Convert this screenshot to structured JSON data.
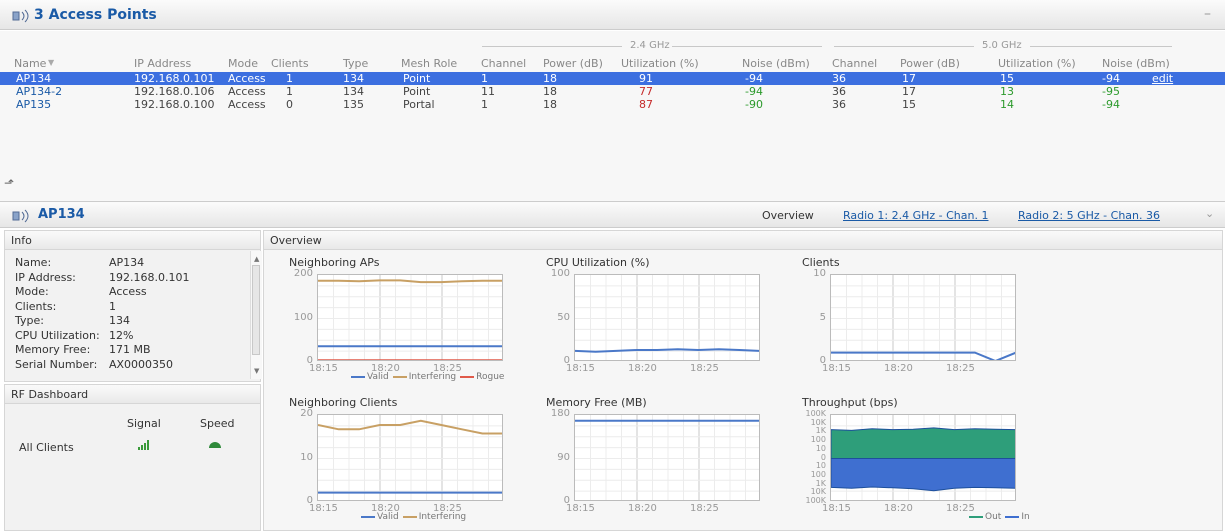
{
  "header": {
    "title": "3 Access Points"
  },
  "table": {
    "group_24": "2.4 GHz",
    "group_5": "5.0 GHz",
    "columns": [
      "Name",
      "IP Address",
      "Mode",
      "Clients",
      "Type",
      "Mesh Role",
      "Channel",
      "Power (dB)",
      "Utilization (%)",
      "Noise (dBm)",
      "Channel",
      "Power (dB)",
      "Utilization (%)",
      "Noise (dBm)"
    ],
    "rows": [
      {
        "name": "AP134",
        "ip": "192.168.0.101",
        "mode": "Access",
        "clients": "1",
        "type": "134",
        "mesh": "Point",
        "ch24": "1",
        "pw24": "18",
        "ut24": "91",
        "no24": "-94",
        "ch5": "36",
        "pw5": "17",
        "ut5": "15",
        "no5": "-94",
        "action": "edit"
      },
      {
        "name": "AP134-2",
        "ip": "192.168.0.106",
        "mode": "Access",
        "clients": "1",
        "type": "134",
        "mesh": "Point",
        "ch24": "11",
        "pw24": "18",
        "ut24": "77",
        "no24": "-94",
        "ch5": "36",
        "pw5": "17",
        "ut5": "13",
        "no5": "-95",
        "action": ""
      },
      {
        "name": "AP135",
        "ip": "192.168.0.100",
        "mode": "Access",
        "clients": "0",
        "type": "135",
        "mesh": "Portal",
        "ch24": "1",
        "pw24": "18",
        "ut24": "87",
        "no24": "-90",
        "ch5": "36",
        "pw5": "15",
        "ut5": "14",
        "no5": "-94",
        "action": ""
      }
    ]
  },
  "ap": {
    "title": "AP134",
    "overview": "Overview",
    "radio1": "Radio 1: 2.4 GHz - Chan. 1",
    "radio2": "Radio 2: 5 GHz - Chan. 36"
  },
  "info": {
    "title": "Info",
    "rows": [
      {
        "k": "Name:",
        "v": "AP134"
      },
      {
        "k": "IP Address:",
        "v": "192.168.0.101"
      },
      {
        "k": "Mode:",
        "v": "Access"
      },
      {
        "k": "Clients:",
        "v": "1"
      },
      {
        "k": "Type:",
        "v": "134"
      },
      {
        "k": "CPU Utilization:",
        "v": "12%"
      },
      {
        "k": "Memory Free:",
        "v": "171 MB"
      },
      {
        "k": "Serial Number:",
        "v": "AX0000350"
      }
    ]
  },
  "rf": {
    "title": "RF Dashboard",
    "signal": "Signal",
    "speed": "Speed",
    "row": "All Clients"
  },
  "overview": {
    "title": "Overview"
  },
  "colors": {
    "valid": "#4a78c8",
    "interfering": "#c8a064",
    "rogue": "#e05a4a",
    "out": "#2e9e7a",
    "in": "#3f6fd0"
  },
  "chart_data": [
    {
      "type": "line",
      "title": "Neighboring APs",
      "x": [
        "18:15",
        "18:20",
        "18:25"
      ],
      "ylim": [
        0,
        200
      ],
      "yticks": [
        "200",
        "100",
        "0"
      ],
      "series": [
        {
          "name": "Valid",
          "values": [
            35,
            35,
            35,
            35,
            35,
            35,
            35,
            35,
            35,
            35
          ]
        },
        {
          "name": "Interfering",
          "values": [
            190,
            190,
            189,
            191,
            191,
            187,
            187,
            189,
            190,
            190
          ]
        },
        {
          "name": "Rogue",
          "values": [
            2,
            2,
            2,
            2,
            2,
            2,
            2,
            2,
            2,
            2
          ]
        }
      ]
    },
    {
      "type": "line",
      "title": "CPU Utilization  (%)",
      "x": [
        "18:15",
        "18:20",
        "18:25"
      ],
      "ylim": [
        0,
        100
      ],
      "yticks": [
        "100",
        "50",
        "0"
      ],
      "series": [
        {
          "values": [
            12,
            11,
            12,
            13,
            13,
            14,
            13,
            14,
            13,
            12
          ]
        }
      ]
    },
    {
      "type": "line",
      "title": "Clients",
      "x": [
        "18:15",
        "18:20",
        "18:25"
      ],
      "ylim": [
        0,
        10
      ],
      "yticks": [
        "10",
        "5",
        "0"
      ],
      "series": [
        {
          "values": [
            1,
            1,
            1,
            1,
            1,
            1,
            1,
            1,
            0,
            1
          ]
        }
      ]
    },
    {
      "type": "line",
      "title": "Neighboring Clients",
      "x": [
        "18:15",
        "18:20",
        "18:25"
      ],
      "ylim": [
        0,
        20
      ],
      "yticks": [
        "20",
        "10",
        "0"
      ],
      "series": [
        {
          "name": "Valid",
          "values": [
            2,
            2,
            2,
            2,
            2,
            2,
            2,
            2,
            2,
            2
          ]
        },
        {
          "name": "Interfering",
          "values": [
            18,
            17,
            17,
            18,
            18,
            19,
            18,
            17,
            16,
            16
          ]
        }
      ]
    },
    {
      "type": "line",
      "title": "Memory Free  (MB)",
      "x": [
        "18:15",
        "18:20",
        "18:25"
      ],
      "ylim": [
        0,
        180
      ],
      "yticks": [
        "180",
        "90",
        "0"
      ],
      "series": [
        {
          "values": [
            171,
            171,
            171,
            171,
            171,
            171,
            171,
            171,
            171,
            171
          ]
        }
      ]
    },
    {
      "type": "area",
      "title": "Throughput  (bps)",
      "x": [
        "18:15",
        "18:20",
        "18:25"
      ],
      "yticks": [
        "100K",
        "10K",
        "1K",
        "100",
        "10",
        "0",
        "10",
        "100",
        "1K",
        "10K",
        "100K"
      ],
      "series": [
        {
          "name": "Out",
          "values": [
            70,
            68,
            72,
            70,
            71,
            74,
            70,
            72,
            71,
            70
          ]
        },
        {
          "name": "In",
          "values": [
            70,
            72,
            69,
            71,
            73,
            78,
            72,
            70,
            71,
            72
          ]
        }
      ]
    }
  ]
}
